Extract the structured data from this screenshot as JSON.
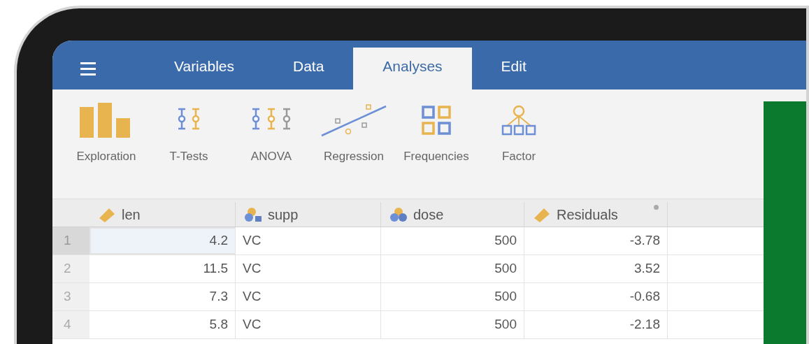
{
  "tabs": [
    {
      "label": "Variables",
      "selected": false
    },
    {
      "label": "Data",
      "selected": false
    },
    {
      "label": "Analyses",
      "selected": true
    },
    {
      "label": "Edit",
      "selected": false
    }
  ],
  "ribbon": [
    {
      "label": "Exploration",
      "kind": "bars"
    },
    {
      "label": "T-Tests",
      "kind": "ttest"
    },
    {
      "label": "ANOVA",
      "kind": "anova"
    },
    {
      "label": "Regression",
      "kind": "regression"
    },
    {
      "label": "Frequencies",
      "kind": "frequencies"
    },
    {
      "label": "Factor",
      "kind": "factor"
    }
  ],
  "table": {
    "columns": [
      {
        "name": "len",
        "kind": "continuous",
        "computed": false
      },
      {
        "name": "supp",
        "kind": "nominal_text",
        "computed": false
      },
      {
        "name": "dose",
        "kind": "nominal",
        "computed": false
      },
      {
        "name": "Residuals",
        "kind": "continuous",
        "computed": true
      }
    ],
    "rows": [
      {
        "number": "1",
        "selected": true,
        "cells": [
          "4.2",
          "VC",
          "500",
          "-3.78"
        ]
      },
      {
        "number": "2",
        "selected": false,
        "cells": [
          "11.5",
          "VC",
          "500",
          "3.52"
        ]
      },
      {
        "number": "3",
        "selected": false,
        "cells": [
          "7.3",
          "VC",
          "500",
          "-0.68"
        ]
      },
      {
        "number": "4",
        "selected": false,
        "cells": [
          "5.8",
          "VC",
          "500",
          "-2.18"
        ]
      }
    ]
  }
}
